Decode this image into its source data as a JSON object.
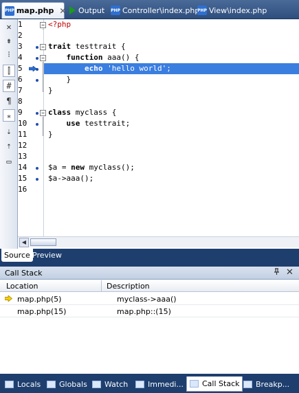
{
  "tabs": [
    {
      "label": "map.php",
      "icon": "php-file-icon"
    },
    {
      "label": "Output",
      "icon": "play-icon"
    },
    {
      "label": "Controller\\index.php",
      "icon": "php-file-icon"
    },
    {
      "label": "View\\index.php",
      "icon": "php-file-icon"
    }
  ],
  "toolbar": {
    "icons": [
      "close-icon",
      "indent-icon",
      "outdent-icon",
      "toggle-bookmark-icon",
      "hash-icon",
      "paragraph-icon",
      "insert-icon",
      "comment-icon",
      "uncomment-icon",
      "monitor-icon"
    ]
  },
  "editor": {
    "line_numbers": [
      "1",
      "2",
      "3",
      "4",
      "5",
      "6",
      "7",
      "8",
      "9",
      "10",
      "11",
      "12",
      "13",
      "14",
      "15",
      "16"
    ],
    "current_line": "5",
    "code": {
      "l1": "<?php",
      "l3_kw": "trait",
      "l3_rest": " testtrait {",
      "l4_kw": "function",
      "l4_rest": " aaa() {",
      "l5_kw": "echo",
      "l5_str": " 'hello world'",
      "l5_end": ";",
      "l6": "}",
      "l7": "}",
      "l9_kw": "class",
      "l9_rest": " myclass {",
      "l10_kw": "use",
      "l10_rest": " testtrait;",
      "l11": "}",
      "l14_a": "$a = ",
      "l14_kw": "new",
      "l14_b": " myclass();",
      "l15": "$a->aaa();"
    },
    "highlight_color": "#3a7ee0"
  },
  "source_tabs": {
    "source": "Source",
    "preview": "Preview"
  },
  "callstack": {
    "title": "Call Stack",
    "pin": "―",
    "close": "✕",
    "columns": {
      "location": "Location",
      "description": "Description"
    },
    "rows": [
      {
        "location": "map.php(5)",
        "description": "myclass->aaa()",
        "current": true
      },
      {
        "location": "map.php(15)",
        "description": "map.php::(15)",
        "current": false
      }
    ]
  },
  "bottom_tabs": [
    {
      "label": "Locals"
    },
    {
      "label": "Globals"
    },
    {
      "label": "Watch"
    },
    {
      "label": "Immedi..."
    },
    {
      "label": "Call Stack"
    },
    {
      "label": "Breakp..."
    }
  ]
}
